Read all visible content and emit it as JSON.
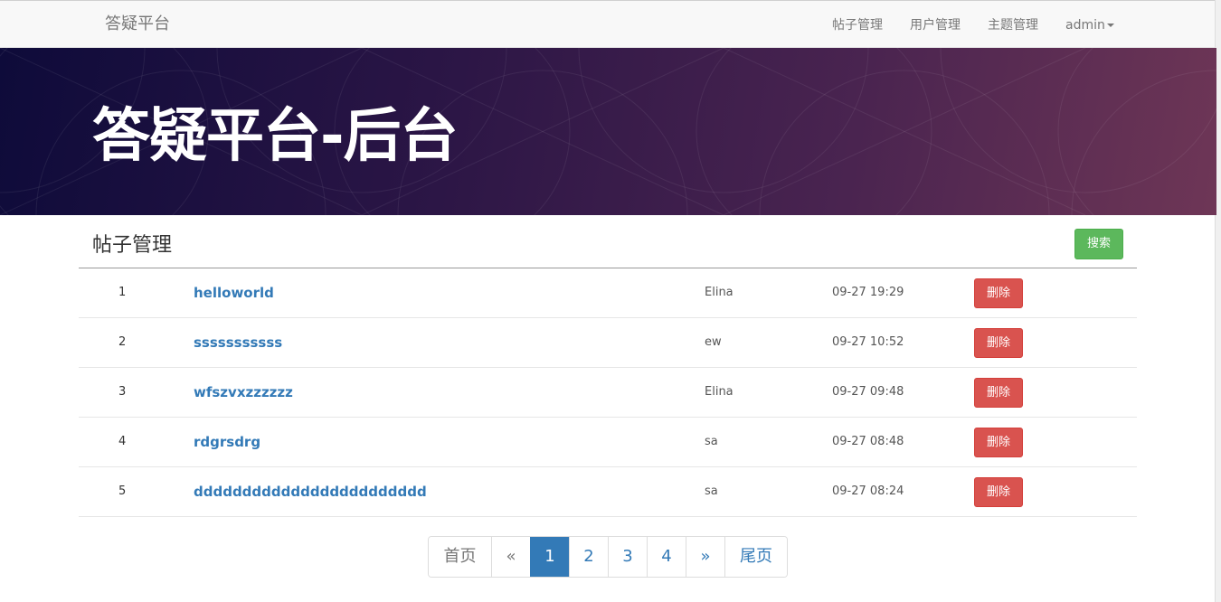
{
  "navbar": {
    "brand": "答疑平台",
    "links": [
      {
        "label": "帖子管理"
      },
      {
        "label": "用户管理"
      },
      {
        "label": "主题管理"
      }
    ],
    "user": "admin"
  },
  "hero": {
    "title": "答疑平台-后台"
  },
  "section": {
    "title": "帖子管理",
    "search_label": "搜索"
  },
  "posts": [
    {
      "index": "1",
      "title": "helloworld",
      "author": "Elina",
      "time": "09-27 19:29",
      "delete_label": "删除"
    },
    {
      "index": "2",
      "title": "sssssssssss",
      "author": "ew",
      "time": "09-27 10:52",
      "delete_label": "删除"
    },
    {
      "index": "3",
      "title": "wfszvxzzzzzz",
      "author": "Elina",
      "time": "09-27 09:48",
      "delete_label": "删除"
    },
    {
      "index": "4",
      "title": "rdgrsdrg",
      "author": "sa",
      "time": "09-27 08:48",
      "delete_label": "删除"
    },
    {
      "index": "5",
      "title": "dddddddddddddddddddddddd",
      "author": "sa",
      "time": "09-27 08:24",
      "delete_label": "删除"
    }
  ],
  "pagination": {
    "first": "首页",
    "prev": "«",
    "pages": [
      "1",
      "2",
      "3",
      "4"
    ],
    "current": "1",
    "next": "»",
    "last": "尾页"
  },
  "colors": {
    "brand_blue": "#337ab7",
    "success_green": "#5cb85c",
    "danger_red": "#d9534f"
  }
}
